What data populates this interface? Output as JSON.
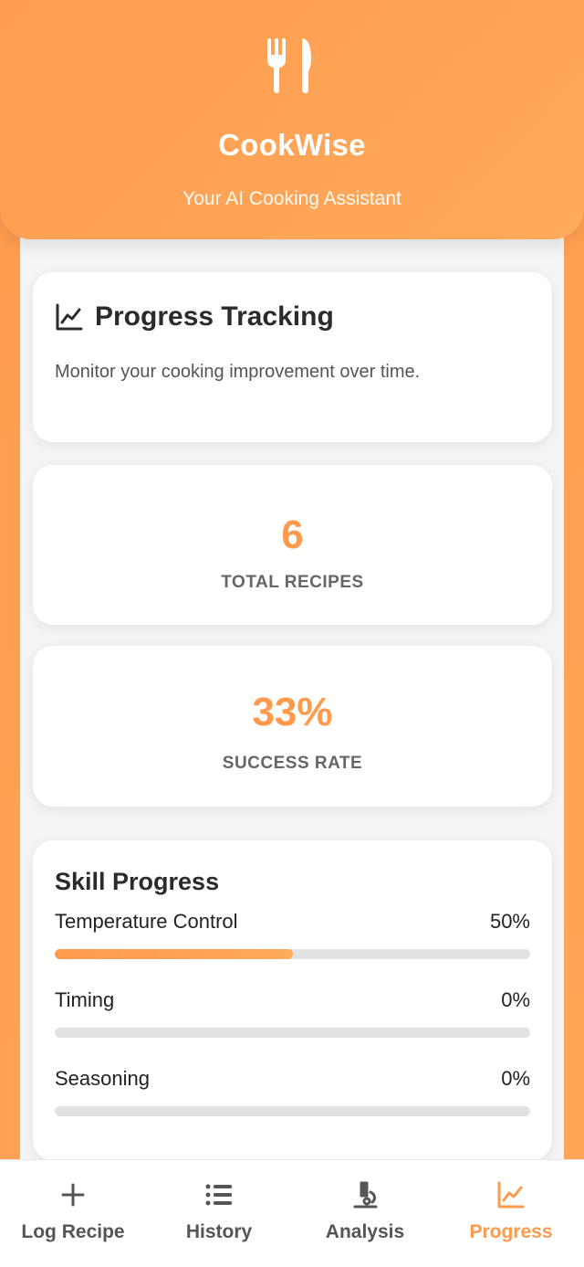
{
  "header": {
    "logo_icon": "utensils-icon",
    "title": "CookWise",
    "subtitle": "Your AI Cooking Assistant"
  },
  "intro": {
    "icon": "chart-line-icon",
    "title": "Progress Tracking",
    "description": "Monitor your cooking improvement over time."
  },
  "stats": {
    "total_recipes": {
      "value": "6",
      "label": "TOTAL RECIPES"
    },
    "success_rate": {
      "value": "33%",
      "label": "SUCCESS RATE"
    }
  },
  "skills": {
    "title": "Skill Progress",
    "items": [
      {
        "name": "Temperature Control",
        "percent_label": "50%",
        "fraction": 0.5
      },
      {
        "name": "Timing",
        "percent_label": "0%",
        "fraction": 0
      },
      {
        "name": "Seasoning",
        "percent_label": "0%",
        "fraction": 0
      }
    ]
  },
  "nav": {
    "items": [
      {
        "label": "Log Recipe",
        "icon": "plus-icon",
        "active": false
      },
      {
        "label": "History",
        "icon": "list-icon",
        "active": false
      },
      {
        "label": "Analysis",
        "icon": "microscope-icon",
        "active": false
      },
      {
        "label": "Progress",
        "icon": "chart-line-icon",
        "active": true
      }
    ]
  },
  "colors": {
    "accent": "#ff9a4d",
    "track": "#e2e2e2"
  }
}
